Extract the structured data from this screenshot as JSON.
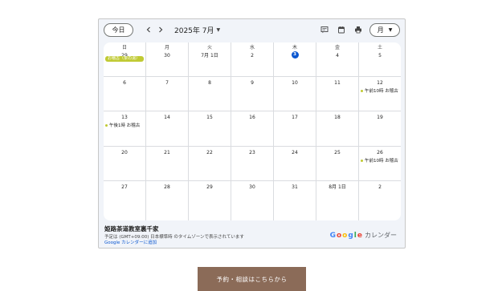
{
  "toolbar": {
    "today_label": "今日",
    "prev_icon": "chevron-left-icon",
    "next_icon": "chevron-right-icon",
    "month_title": "2025年 7月",
    "view_label": "月",
    "icons": [
      "agenda-icon",
      "calendar-icon",
      "print-icon"
    ]
  },
  "grid": {
    "weekdays": [
      "日",
      "月",
      "火",
      "水",
      "木",
      "金",
      "土"
    ],
    "weeks": [
      [
        {
          "date": "29",
          "events": [
            {
              "label": "お稽古（茶の湯）",
              "type": "allday"
            }
          ]
        },
        {
          "date": "30",
          "events": []
        },
        {
          "date": "7月 1日",
          "events": []
        },
        {
          "date": "2",
          "events": []
        },
        {
          "date": "3",
          "today": true,
          "events": []
        },
        {
          "date": "4",
          "events": []
        },
        {
          "date": "5",
          "events": []
        }
      ],
      [
        {
          "date": "6",
          "events": []
        },
        {
          "date": "7",
          "events": []
        },
        {
          "date": "8",
          "events": []
        },
        {
          "date": "9",
          "events": []
        },
        {
          "date": "10",
          "events": []
        },
        {
          "date": "11",
          "events": []
        },
        {
          "date": "12",
          "events": [
            {
              "label": "午前10時 お稽古",
              "type": "timed"
            }
          ]
        }
      ],
      [
        {
          "date": "13",
          "events": [
            {
              "label": "午後1時 お稽古",
              "type": "timed"
            }
          ]
        },
        {
          "date": "14",
          "events": []
        },
        {
          "date": "15",
          "events": []
        },
        {
          "date": "16",
          "events": []
        },
        {
          "date": "17",
          "events": []
        },
        {
          "date": "18",
          "events": []
        },
        {
          "date": "19",
          "events": []
        }
      ],
      [
        {
          "date": "20",
          "events": []
        },
        {
          "date": "21",
          "events": []
        },
        {
          "date": "22",
          "events": []
        },
        {
          "date": "23",
          "events": []
        },
        {
          "date": "24",
          "events": []
        },
        {
          "date": "25",
          "events": []
        },
        {
          "date": "26",
          "events": [
            {
              "label": "午前10時 お稽古",
              "type": "timed"
            }
          ]
        }
      ],
      [
        {
          "date": "27",
          "events": []
        },
        {
          "date": "28",
          "events": []
        },
        {
          "date": "29",
          "events": []
        },
        {
          "date": "30",
          "events": []
        },
        {
          "date": "31",
          "events": []
        },
        {
          "date": "8月 1日",
          "events": []
        },
        {
          "date": "2",
          "events": []
        }
      ]
    ]
  },
  "footer": {
    "calendar_title": "姫路茶道教室裏千家",
    "timezone_note": "予定は (GMT+09:00) 日本標準時 のタイムゾーンで表示されています",
    "add_link": "Google カレンダーに追加",
    "brand_letters": [
      "G",
      "o",
      "o",
      "g",
      "l",
      "e"
    ],
    "brand_colors": [
      "#4285f4",
      "#ea4335",
      "#fbbc05",
      "#4285f4",
      "#34a853",
      "#ea4335"
    ],
    "brand_suffix": "カレンダー"
  },
  "cta": {
    "label": "予約・相談はこちらから"
  },
  "colors": {
    "event": "#c0ca33",
    "today": "#0b57d0",
    "cta_bg": "#8b6b58"
  }
}
